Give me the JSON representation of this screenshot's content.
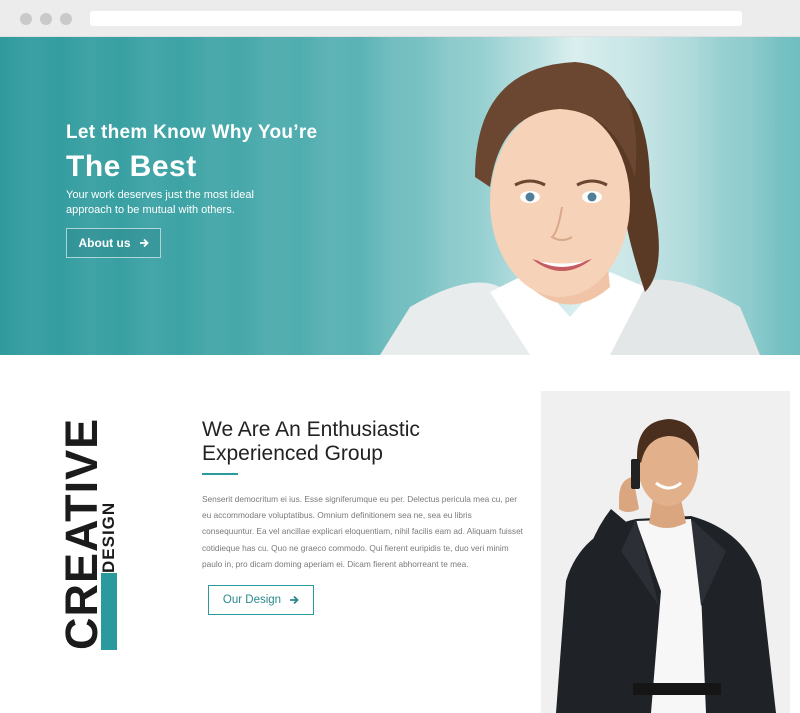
{
  "hero": {
    "title_line1": "Let them Know Why You’re",
    "title_line2": "The Best",
    "subtitle": "Your work deserves just the most ideal approach to be mutual with others.",
    "button_label": "About us",
    "button_icon": "arrow-right-icon"
  },
  "vertical_logo": {
    "word1": "CREATIVE",
    "word2": "DESIGN"
  },
  "section": {
    "title": "We Are An Enthusiastic Experienced Group",
    "body": "Senserit democritum ei ius. Esse signiferumque eu per. Delectus pericula mea cu, per eu accommodare voluptatibus. Omnium definitionem sea ne, sea eu libris consequuntur. Ea vel ancillae explicari eloquentiam, nihil facilis eam ad. Aliquam fuisset cotidieque has cu. Quo ne graeco commodo. Qui fierent euripidis te, duo veri minim paulo in, pro dicam doming aperiam ei. Dicam fierent abhorreant te mea.",
    "button_label": "Our Design",
    "button_icon": "arrow-right-icon"
  },
  "colors": {
    "accent": "#2b9a9c",
    "hero_base": "#3fa4a6"
  }
}
